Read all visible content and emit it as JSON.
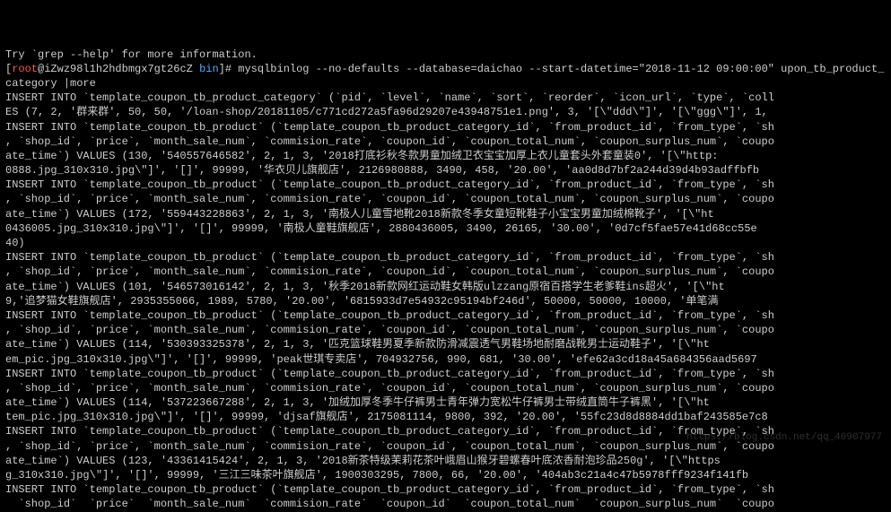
{
  "top_fragment": "Try `grep --help' for more information.",
  "prompt": {
    "user": "root",
    "at": "@",
    "host": "iZwz98l1h2hdbmgx7gt26cZ",
    "dir": "bin",
    "end": "]#"
  },
  "command": "mysqlbinlog --no-defaults --database=daichao --start-datetime=\"2018-11-12 09:00:00\" upon_tb_product_category |more",
  "lines": [
    "INSERT INTO `template_coupon_tb_product_category` (`pid`, `level`, `name`, `sort`, `reorder`, `icon_url`, `type`, `coll",
    "ES (7, 2, '群来群', 50, 50, '/loan-shop/20181105/c771cd272a5fa96d29207e43948751e1.png', 3, '[\\\"ddd\\\"]', '[\\\"ggg\\\"]', 1,",
    "INSERT INTO `template_coupon_tb_product` (`template_coupon_tb_product_category_id`, `from_product_id`, `from_type`, `sh",
    ", `shop_id`, `price`, `month_sale_num`, `commision_rate`, `coupon_id`, `coupon_total_num`, `coupon_surplus_num`, `coupo",
    "ate_time`) VALUES (130, '540557646582', 2, 1, 3, '2018打底衫秋冬款男童加绒卫衣宝宝加厚上衣儿童套头外套童装0', '[\\\"http:",
    "0888.jpg_310x310.jpg\\\"]', '[]', 99999, '华衣贝儿旗舰店', 2126980888, 3490, 458, '20.00', 'aa0d8d7bf2a244d39d4b93adffbfb",
    "INSERT INTO `template_coupon_tb_product` (`template_coupon_tb_product_category_id`, `from_product_id`, `from_type`, `sh",
    ", `shop_id`, `price`, `month_sale_num`, `commision_rate`, `coupon_id`, `coupon_total_num`, `coupon_surplus_num`, `coupo",
    "ate_time`) VALUES (172, '559443228863', 2, 1, 3, '南极人儿童雪地靴2018新款冬季女童短靴鞋子小宝宝男童加绒棉靴子', '[\\\"ht",
    "0436005.jpg_310x310.jpg\\\"]', '[]', 99999, '南极人童鞋旗舰店', 2880436005, 3490, 26165, '30.00', '0d7cf5fae57e41d68cc55e",
    "40)",
    "INSERT INTO `template_coupon_tb_product` (`template_coupon_tb_product_category_id`, `from_product_id`, `from_type`, `sh",
    ", `shop_id`, `price`, `month_sale_num`, `commision_rate`, `coupon_id`, `coupon_total_num`, `coupon_surplus_num`, `coupo",
    "ate_time`) VALUES (101, '546573016142', 2, 1, 3, '秋季2018新款网红运动鞋女韩版ulzzang原宿百搭学生老爹鞋ins超火', '[\\\"ht",
    "9,'追梦猫女鞋旗舰店', 2935355066, 1989, 5780, '20.00', '6815933d7e54932c95194bf246d', 50000, 50000, 10000, '单笔满",
    "INSERT INTO `template_coupon_tb_product` (`template_coupon_tb_product_category_id`, `from_product_id`, `from_type`, `sh",
    ", `shop_id`, `price`, `month_sale_num`, `commision_rate`, `coupon_id`, `coupon_total_num`, `coupon_surplus_num`, `coupo",
    "ate_time`) VALUES (114, '530393325378', 2, 1, 3, '匹克篮球鞋男夏季新款防滑减震透气男鞋场地耐磨战靴男士运动鞋子', '[\\\"ht",
    "em_pic.jpg_310x310.jpg\\\"]', '[]', 99999, 'peak世琪专卖店', 704932756, 990, 681, '30.00', 'efe62a3cd18a45a684356aad5697",
    "INSERT INTO `template_coupon_tb_product` (`template_coupon_tb_product_category_id`, `from_product_id`, `from_type`, `sh",
    ", `shop_id`, `price`, `month_sale_num`, `commision_rate`, `coupon_id`, `coupon_total_num`, `coupon_surplus_num`, `coupo",
    "ate_time`) VALUES (114, '537223667288', 2, 1, 3, '加绒加厚冬季牛仔裤男士青年弹力宽松牛仔裤男士带绒直筒牛子裤黑', '[\\\"ht",
    "tem_pic.jpg_310x310.jpg\\\"]', '[]', 99999, 'djsaf旗舰店', 2175081114, 9800, 392, '20.00', '55fc23d8d8884dd1baf243585e7c8",
    "INSERT INTO `template_coupon_tb_product` (`template_coupon_tb_product_category_id`, `from_product_id`, `from_type`, `sh",
    ", `shop_id`, `price`, `month_sale_num`, `commision_rate`, `coupon_id`, `coupon_total_num`, `coupon_surplus_num`, `coupo",
    "ate_time`) VALUES (123, '43361415424', 2, 1, 3, '2018新茶特级茉莉花茶叶峨眉山猴牙碧螺春叶底浓香耐泡珍品250g', '[\\\"https",
    "g_310x310.jpg\\\"]', '[]', 99999, '三江三味茶叶旗舰店', 1900303295, 7800, 66, '20.00', '404ab3c21a4c47b5978fff9234f141fb",
    "INSERT INTO `template_coupon_tb_product` (`template_coupon_tb_product_category_id`, `from_product_id`, `from_type`, `sh",
    "  `shop_id`  `price`  `month_sale_num`  `commision_rate`  `coupon_id`  `coupon_total_num`  `coupon_surplus_num`  `coupo"
  ],
  "watermark": "https://blog.csdn.net/qq_40907977"
}
